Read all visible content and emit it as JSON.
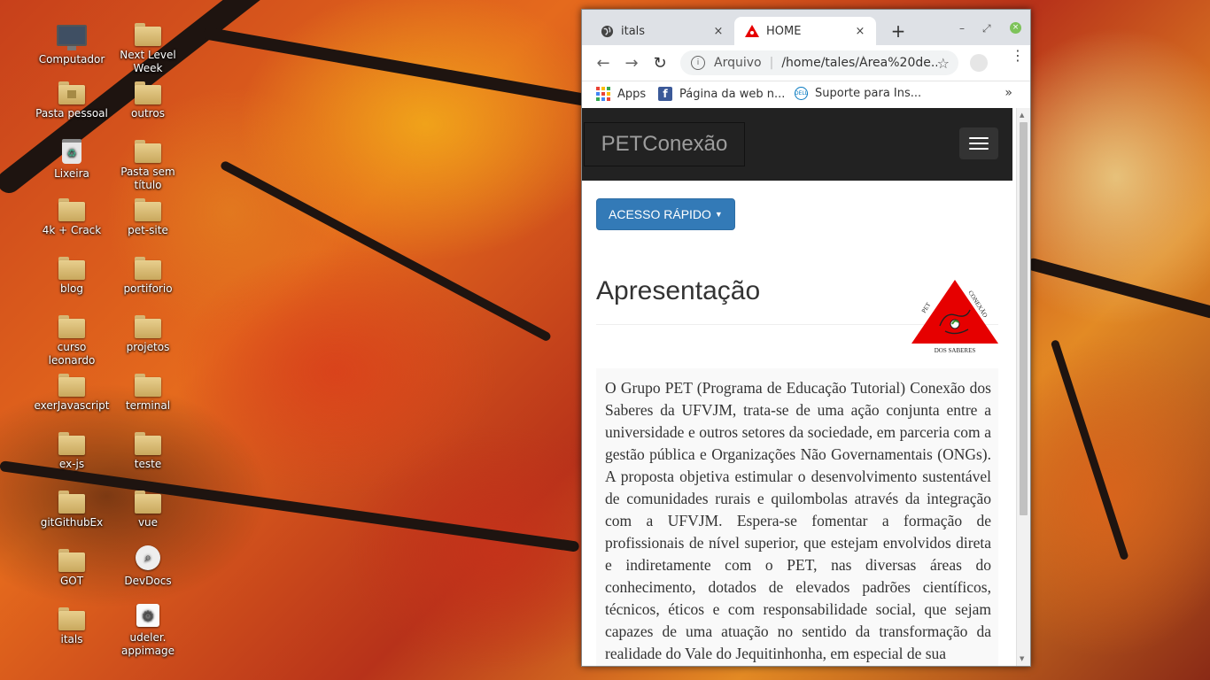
{
  "desktop": {
    "icons": [
      {
        "label": "Computador"
      },
      {
        "label": "Next Level Week"
      },
      {
        "label": "Pasta pessoal"
      },
      {
        "label": "outros"
      },
      {
        "label": "Lixeira"
      },
      {
        "label": "Pasta sem título"
      },
      {
        "label": "4k + Crack"
      },
      {
        "label": "pet-site"
      },
      {
        "label": "blog"
      },
      {
        "label": "portiforio"
      },
      {
        "label": "curso leonardo"
      },
      {
        "label": "projetos"
      },
      {
        "label": "exerJavascript"
      },
      {
        "label": "terminal"
      },
      {
        "label": "ex-js"
      },
      {
        "label": "teste"
      },
      {
        "label": "gitGithubEx"
      },
      {
        "label": "vue"
      },
      {
        "label": "GOT"
      },
      {
        "label": "DevDocs"
      },
      {
        "label": "itals"
      },
      {
        "label": "udeler. appimage"
      }
    ]
  },
  "browser": {
    "tabs": [
      {
        "title": "itals",
        "close": "×"
      },
      {
        "title": "HOME",
        "close": "×"
      }
    ],
    "new_tab": "+",
    "window_controls": {
      "minimize": "–",
      "restore": "⤢",
      "close": "×"
    },
    "nav": {
      "back": "←",
      "forward": "→",
      "reload": "↻"
    },
    "omnibox": {
      "scheme": "Arquivo",
      "separator": "|",
      "url": "/home/tales/Área%20de...",
      "star": "☆"
    },
    "menu": "⋮",
    "bookmarks": [
      {
        "label": "Apps"
      },
      {
        "label": "Página da web n..."
      },
      {
        "label": "Suporte para Ins..."
      }
    ],
    "bookmarks_more": "»"
  },
  "page": {
    "brand": "PETConexão",
    "quick_access": "ACESSO RÁPIDO",
    "caret": "▼",
    "section_title": "Apresentação",
    "logo": {
      "text_top_left": "PET",
      "text_top_right": "CONEXÃO",
      "text_bottom": "DOS SABERES",
      "color": "#e60000"
    },
    "body": "O Grupo PET (Programa de Educação Tutorial) Conexão dos Saberes da UFVJM, trata-se de uma ação conjunta entre a universidade e outros setores da sociedade, em parceria com a gestão pública e Organizações Não Governamentais (ONGs). A proposta objetiva estimular o desenvolvimento sustentável de comunidades rurais e quilombolas através da integração com a UFVJM. Espera-se fomentar a formação de profissionais de nível superior, que estejam envolvidos direta e indiretamente com o PET, nas diversas áreas do conhecimento, dotados de elevados padrões científicos, técnicos, éticos e com responsabilidade social, que sejam capazes de uma atuação no sentido da transformação da realidade do Vale do Jequitinhonha, em especial de sua"
  }
}
